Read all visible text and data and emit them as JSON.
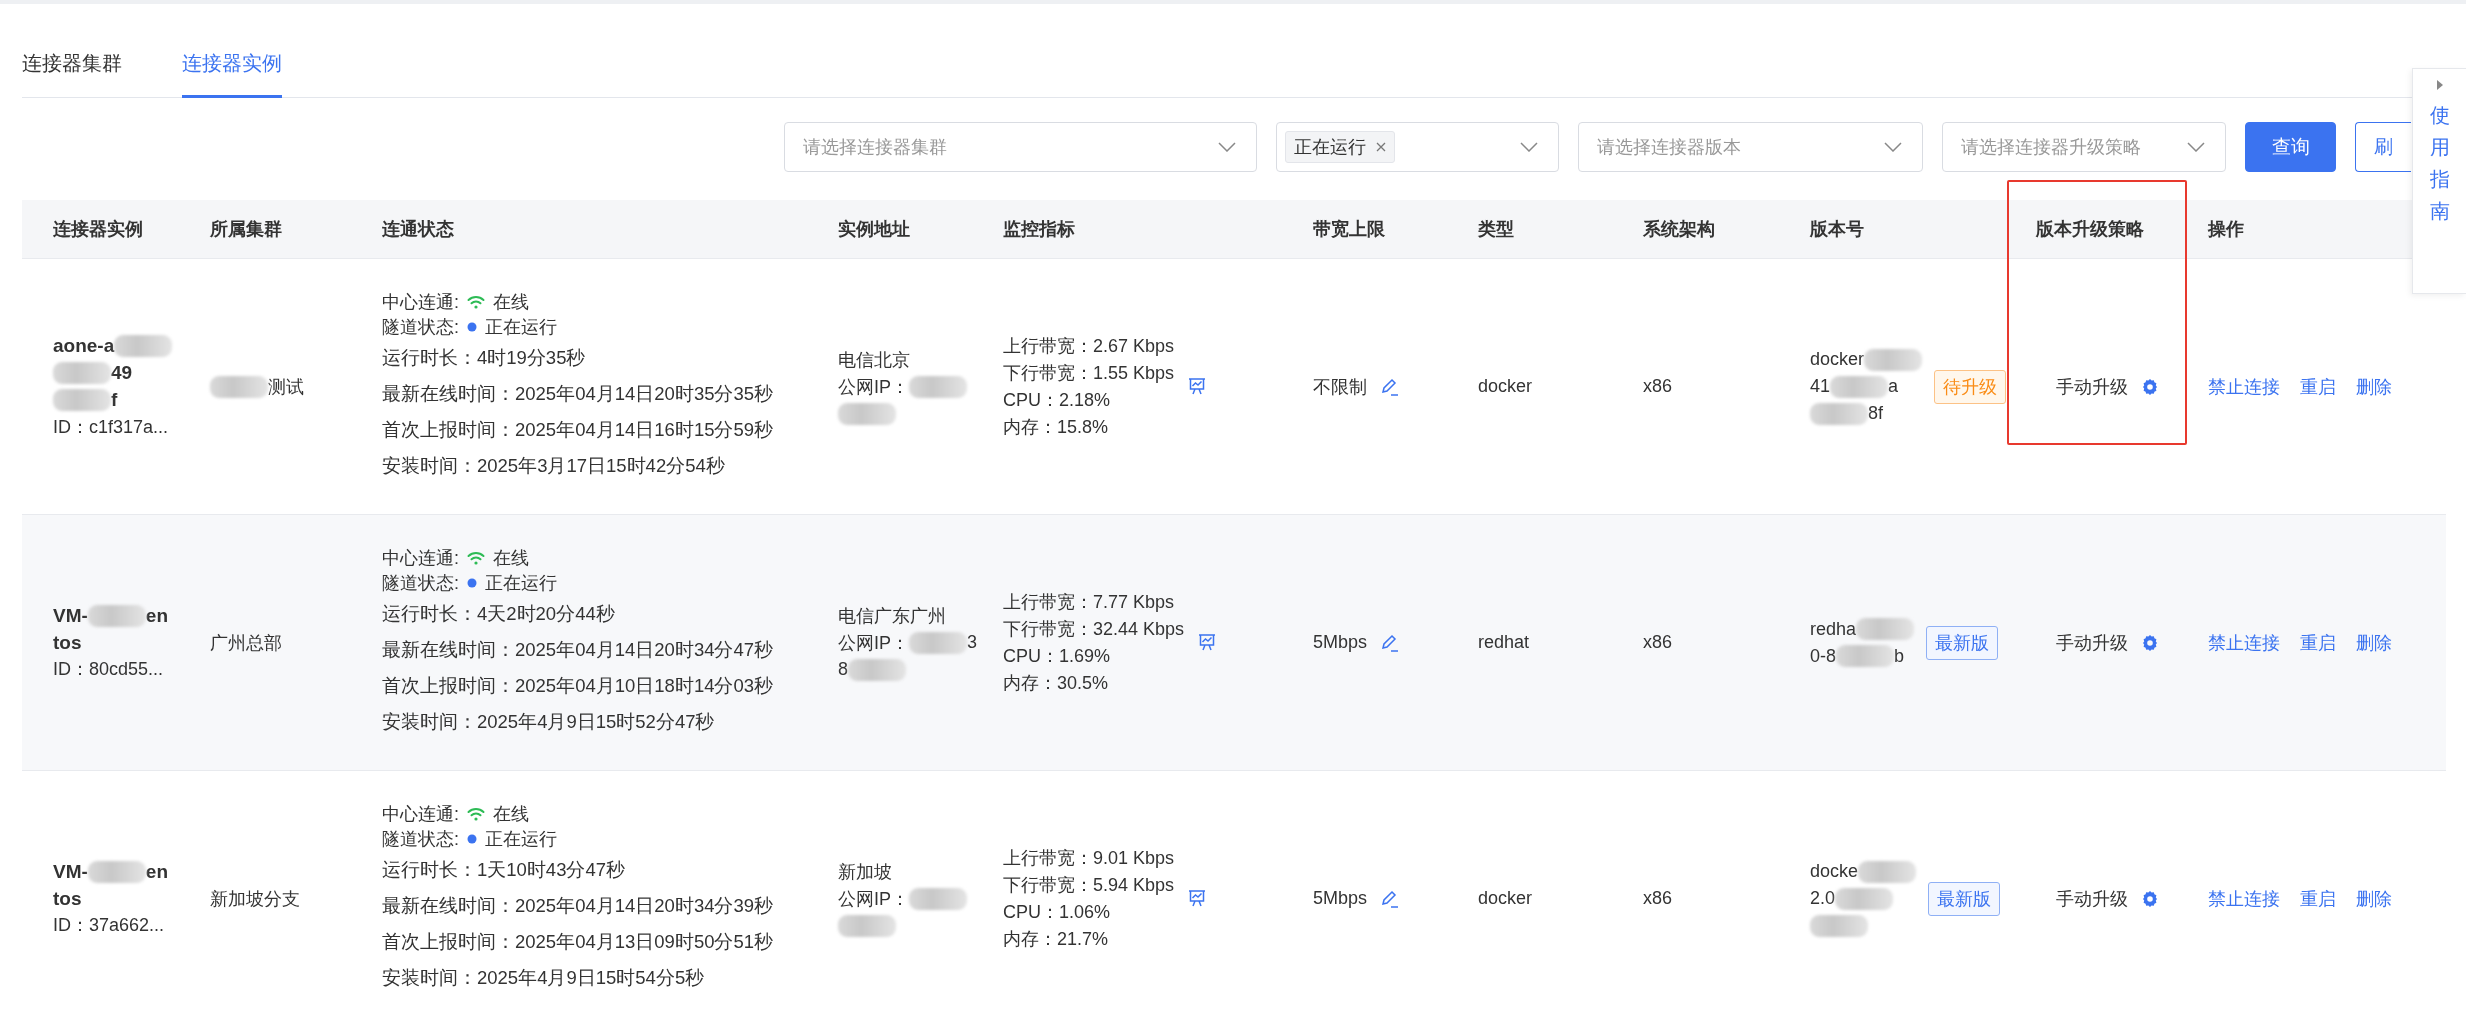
{
  "tabs": [
    {
      "label": "连接器集群",
      "selected": false
    },
    {
      "label": "连接器实例",
      "selected": true
    }
  ],
  "filters": [
    {
      "kind": "select",
      "placeholder": "请选择连接器集群"
    },
    {
      "kind": "tags",
      "tags": [
        "正在运行"
      ]
    },
    {
      "kind": "select",
      "placeholder": "请选择连接器版本"
    },
    {
      "kind": "select",
      "placeholder": "请选择连接器升级策略"
    }
  ],
  "buttons": [
    {
      "label": "查询",
      "primary": true
    },
    {
      "label": "刷",
      "primary": false
    }
  ],
  "guide": {
    "label": "使用指南"
  },
  "table": {
    "columns": [
      {
        "label": "连接器实例",
        "highlighted": false
      },
      {
        "label": "所属集群",
        "highlighted": false
      },
      {
        "label": "连通状态",
        "highlighted": false
      },
      {
        "label": "实例地址",
        "highlighted": false
      },
      {
        "label": "监控指标",
        "highlighted": false
      },
      {
        "label": "带宽上限",
        "highlighted": false
      },
      {
        "label": "类型",
        "highlighted": false
      },
      {
        "label": "系统架构",
        "highlighted": false
      },
      {
        "label": "版本号",
        "highlighted": false
      },
      {
        "label": "版本升级策略",
        "highlighted": true
      },
      {
        "label": "操作",
        "highlighted": false
      }
    ],
    "rows": [
      {
        "hovered": false,
        "name_lines": [
          [
            {
              "kind": "text",
              "text": "aone-a"
            },
            {
              "kind": "redacted"
            }
          ],
          [
            {
              "kind": "redacted"
            },
            {
              "kind": "text",
              "text": "49"
            }
          ],
          [
            {
              "kind": "redacted"
            },
            {
              "kind": "text",
              "text": "f"
            }
          ]
        ],
        "id": "ID：c1f317a...",
        "cluster": [
          {
            "kind": "redacted"
          },
          {
            "kind": "text",
            "text": "测试"
          }
        ],
        "status": {
          "center_label": "中心连通:",
          "center_online": true,
          "center_value": "在线",
          "tunnel_label": "隧道状态:",
          "tunnel_running": true,
          "tunnel_value": "正在运行",
          "details": [
            "运行时长：4时19分35秒",
            "最新在线时间：2025年04月14日20时35分35秒",
            "首次上报时间：2025年04月14日16时15分59秒",
            "安装时间：2025年3月17日15时42分54秒"
          ]
        },
        "address": [
          [
            {
              "kind": "text",
              "text": "电信北京"
            }
          ],
          [
            {
              "kind": "text",
              "text": "公网IP："
            },
            {
              "kind": "redacted"
            }
          ],
          [
            {
              "kind": "redacted"
            }
          ]
        ],
        "metrics": [
          "上行带宽：2.67 Kbps",
          "下行带宽：1.55 Kbps",
          "CPU：2.18%",
          "内存：15.8%"
        ],
        "bandwidth": "不限制",
        "type": "docker",
        "arch": "x86",
        "version": [
          [
            {
              "kind": "text",
              "text": "docker"
            },
            {
              "kind": "redacted"
            }
          ],
          [
            {
              "kind": "text",
              "text": "41"
            },
            {
              "kind": "redacted"
            },
            {
              "kind": "text",
              "text": "a"
            }
          ],
          [
            {
              "kind": "redacted"
            },
            {
              "kind": "text",
              "text": "8f"
            }
          ]
        ],
        "badge": {
          "kind": "pending",
          "text": "待升级"
        },
        "policy": "手动升级",
        "actions": [
          "禁止连接",
          "重启",
          "删除"
        ]
      },
      {
        "hovered": true,
        "name_lines": [
          [
            {
              "kind": "text",
              "text": "VM-"
            },
            {
              "kind": "redacted"
            },
            {
              "kind": "text",
              "text": "en"
            }
          ],
          [
            {
              "kind": "text",
              "text": "tos"
            }
          ]
        ],
        "id": "ID：80cd55...",
        "cluster": [
          {
            "kind": "text",
            "text": "广州总部"
          }
        ],
        "status": {
          "center_label": "中心连通:",
          "center_online": true,
          "center_value": "在线",
          "tunnel_label": "隧道状态:",
          "tunnel_running": true,
          "tunnel_value": "正在运行",
          "details": [
            "运行时长：4天2时20分44秒",
            "最新在线时间：2025年04月14日20时34分47秒",
            "首次上报时间：2025年04月10日18时14分03秒",
            "安装时间：2025年4月9日15时52分47秒"
          ]
        },
        "address": [
          [
            {
              "kind": "text",
              "text": "电信广东广州"
            }
          ],
          [
            {
              "kind": "text",
              "text": "公网IP："
            },
            {
              "kind": "redacted"
            },
            {
              "kind": "text",
              "text": "3"
            }
          ],
          [
            {
              "kind": "text",
              "text": "8"
            },
            {
              "kind": "redacted"
            }
          ]
        ],
        "metrics": [
          "上行带宽：7.77 Kbps",
          "下行带宽：32.44 Kbps",
          "CPU：1.69%",
          "内存：30.5%"
        ],
        "bandwidth": "5Mbps",
        "type": "redhat",
        "arch": "x86",
        "version": [
          [
            {
              "kind": "text",
              "text": "redha"
            },
            {
              "kind": "redacted"
            }
          ],
          [
            {
              "kind": "text",
              "text": "0-8"
            },
            {
              "kind": "redacted"
            },
            {
              "kind": "text",
              "text": "b"
            }
          ]
        ],
        "badge": {
          "kind": "latest",
          "text": "最新版"
        },
        "policy": "手动升级",
        "actions": [
          "禁止连接",
          "重启",
          "删除"
        ]
      },
      {
        "hovered": false,
        "name_lines": [
          [
            {
              "kind": "text",
              "text": "VM-"
            },
            {
              "kind": "redacted"
            },
            {
              "kind": "text",
              "text": "en"
            }
          ],
          [
            {
              "kind": "text",
              "text": "tos"
            }
          ]
        ],
        "id": "ID：37a662...",
        "cluster": [
          {
            "kind": "text",
            "text": "新加坡分支"
          }
        ],
        "status": {
          "center_label": "中心连通:",
          "center_online": true,
          "center_value": "在线",
          "tunnel_label": "隧道状态:",
          "tunnel_running": true,
          "tunnel_value": "正在运行",
          "details": [
            "运行时长：1天10时43分47秒",
            "最新在线时间：2025年04月14日20时34分39秒",
            "首次上报时间：2025年04月13日09时50分51秒",
            "安装时间：2025年4月9日15时54分5秒"
          ]
        },
        "address": [
          [
            {
              "kind": "text",
              "text": "新加坡"
            }
          ],
          [
            {
              "kind": "text",
              "text": "公网IP："
            },
            {
              "kind": "redacted"
            }
          ],
          [
            {
              "kind": "redacted"
            }
          ]
        ],
        "metrics": [
          "上行带宽：9.01 Kbps",
          "下行带宽：5.94 Kbps",
          "CPU：1.06%",
          "内存：21.7%"
        ],
        "bandwidth": "5Mbps",
        "type": "docker",
        "arch": "x86",
        "version": [
          [
            {
              "kind": "text",
              "text": "docke"
            },
            {
              "kind": "redacted"
            }
          ],
          [
            {
              "kind": "text",
              "text": "2.0"
            },
            {
              "kind": "redacted"
            }
          ],
          [
            {
              "kind": "redacted"
            }
          ]
        ],
        "badge": {
          "kind": "latest",
          "text": "最新版"
        },
        "policy": "手动升级",
        "actions": [
          "禁止连接",
          "重启",
          "删除"
        ]
      }
    ]
  }
}
